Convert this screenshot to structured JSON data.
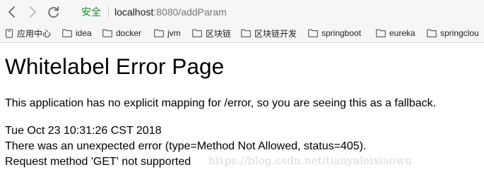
{
  "toolbar": {
    "back_icon": "chevron-left-icon",
    "forward_icon": "chevron-right-icon",
    "reload_icon": "reload-icon",
    "security_label": "安全",
    "url_host": "localhost",
    "url_rest": ":8080/addParam"
  },
  "bookmarks": {
    "items": [
      {
        "label": "应用中心",
        "icon": "apps-icon"
      },
      {
        "label": "idea",
        "icon": "folder-icon"
      },
      {
        "label": "docker",
        "icon": "folder-icon"
      },
      {
        "label": "jvm",
        "icon": "folder-icon"
      },
      {
        "label": "区块链",
        "icon": "folder-icon"
      },
      {
        "label": "区块链开发",
        "icon": "folder-icon"
      },
      {
        "label": "springboot",
        "icon": "folder-icon"
      },
      {
        "label": "eureka",
        "icon": "folder-icon"
      },
      {
        "label": "springclou",
        "icon": "folder-icon"
      }
    ]
  },
  "page": {
    "title": "Whitelabel Error Page",
    "description": "This application has no explicit mapping for /error, so you are seeing this as a fallback.",
    "timestamp": "Tue Oct 23 10:31:26 CST 2018",
    "error_line": "There was an unexpected error (type=Method Not Allowed, status=405).",
    "method_line": "Request method 'GET' not supported"
  },
  "watermark": "https://blog.csdn.net/tianyaleixiaowu",
  "colors": {
    "secure_green": "#1a8a2e",
    "toolbar_bg": "#f6f6f6",
    "url_muted": "#777777",
    "watermark": "#d9d9d9"
  }
}
